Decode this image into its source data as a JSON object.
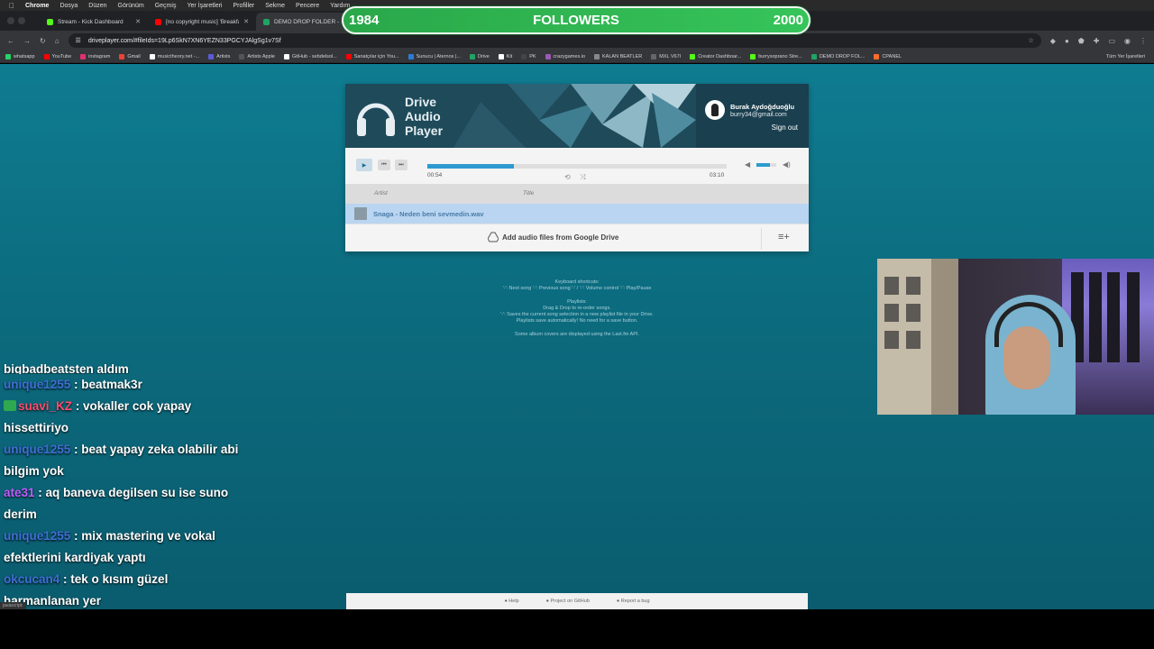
{
  "menubar": {
    "items": [
      "Chrome",
      "Dosya",
      "Düzen",
      "Görünüm",
      "Geçmiş",
      "Yer İşaretleri",
      "Profiller",
      "Sekme",
      "Pencere",
      "Yardım"
    ]
  },
  "tabs": [
    {
      "label": "Stream - Kick Dashboard",
      "color": "#53fc18"
    },
    {
      "label": "[no copyright music] 'Breakfa",
      "color": "#ff0000"
    },
    {
      "label": "DEMO DROP FOLDER - Goo",
      "color": "#1fa463"
    }
  ],
  "address": {
    "url": "driveplayer.com/#fileIds=19Lp6SkN7XN6YEZN33PGCYJAlgSg1v7Sf"
  },
  "bookmarks": [
    {
      "label": "whatsapp",
      "color": "#25d366"
    },
    {
      "label": "YouTube",
      "color": "#ff0000"
    },
    {
      "label": "instagram",
      "color": "#e1306c"
    },
    {
      "label": "Gmail",
      "color": "#ea4335"
    },
    {
      "label": "musictheory.net -...",
      "color": "#ffffff"
    },
    {
      "label": "Artists",
      "color": "#5b5bd6"
    },
    {
      "label": "Artists Apple",
      "color": "#555555"
    },
    {
      "label": "GitHub - sebdelsol...",
      "color": "#ffffff"
    },
    {
      "label": "Sanatçılar için You...",
      "color": "#ff0000"
    },
    {
      "label": "Sunucu | Aternos |...",
      "color": "#2b7bd6"
    },
    {
      "label": "Drive",
      "color": "#1fa463"
    },
    {
      "label": "Kit",
      "color": "#ffffff"
    },
    {
      "label": "PK",
      "color": "#444444"
    },
    {
      "label": "crazygames.io",
      "color": "#9b59b6"
    },
    {
      "label": "KALAN BEATLER",
      "color": "#888888"
    },
    {
      "label": "MXL V67I",
      "color": "#666666"
    },
    {
      "label": "Creator Dashboar...",
      "color": "#53fc18"
    },
    {
      "label": "burrysoprano Stre...",
      "color": "#53fc18"
    },
    {
      "label": "DEMO DROP FOL...",
      "color": "#1fa463"
    },
    {
      "label": "CPANEL",
      "color": "#ff6c2c"
    }
  ],
  "bookmarks_all": "Tüm Yer İşaretleri",
  "player": {
    "brand": [
      "Drive",
      "Audio",
      "Player"
    ],
    "user_name": "Burak Aydoğduoğlu",
    "user_email": "burry34@gmail.com",
    "sign_out": "Sign out",
    "current_time": "00:54",
    "total_time": "03:10",
    "progress": 0.29,
    "volume": 0.7,
    "col_artist": "Artist",
    "col_title": "Title",
    "track": "Snaga - Neden beni sevmedin.wav",
    "add_files": "Add audio files from Google Drive"
  },
  "help": {
    "kb_title": "Keyboard shortcuts:",
    "kb_text": "'-': Next song  '-': Previous song  '-' / '-': Volume control  '-': Play/Pause",
    "pl_title": "Playlists:",
    "pl_line1": "Drag & Drop to re-order songs.",
    "pl_line2": "'-': Saves the current song selection in a new playlist file in your Drive.",
    "pl_line3": "Playlists save automatically! No need for a save button.",
    "covers": "Some album covers are displayed using the Last.fm API."
  },
  "footer": {
    "help": "Help",
    "github": "Project on GitHub",
    "bug": "Report a bug"
  },
  "chat": {
    "cut_line": "bigbadbeatsten aldım",
    "messages": [
      {
        "user": "unique1255",
        "color": "#3f6fd6",
        "text": "beatmak3r",
        "cont": ""
      },
      {
        "user": "suavi_KZ",
        "color": "#ff4d6d",
        "text": "vokaller cok yapay",
        "cont": "hissettiriyo",
        "badge": true
      },
      {
        "user": "unique1255",
        "color": "#3f6fd6",
        "text": "beat yapay zeka olabilir abi",
        "cont": "bilgim yok"
      },
      {
        "user": "ate31",
        "color": "#c05bff",
        "text": "aq baneva degilsen su ise suno",
        "cont": "derim"
      },
      {
        "user": "unique1255",
        "color": "#3f6fd6",
        "text": "mix mastering ve vokal",
        "cont": "efektlerini kardiyak yaptı"
      },
      {
        "user": "okcucan4",
        "color": "#3f6fd6",
        "text": "tek o kısım güzel",
        "cont": "harmanlanan yer"
      }
    ]
  },
  "status": "javascript:",
  "followers": {
    "current": "1984",
    "label": "FOLLOWERS",
    "goal": "2000"
  }
}
